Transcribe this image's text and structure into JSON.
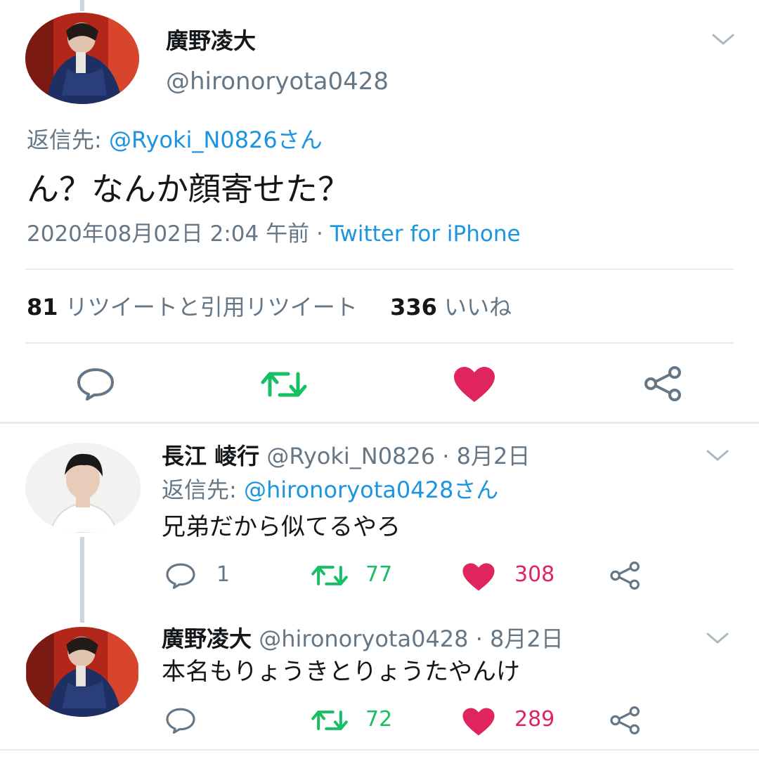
{
  "colors": {
    "link": "#1b95e0",
    "muted": "#657786",
    "retweet_green": "#17bf63",
    "like_red": "#e0245e",
    "divider": "#e6ecf0"
  },
  "main_tweet": {
    "display_name": "廣野凌大",
    "handle": "@hironoryota0428",
    "reply_prefix": "返信先:",
    "reply_to": "@Ryoki_N0826さん",
    "text": "ん？なんか顔寄せた？",
    "timestamp": "2020年08月02日 2:04 午前",
    "separator": "·",
    "source": "Twitter for iPhone",
    "retweet_count": "81",
    "retweet_label": "リツイートと引用リツイート",
    "like_count": "336",
    "like_label": "いいね",
    "icons": [
      "reply-icon",
      "retweet-icon",
      "heart-icon",
      "share-icon",
      "chevron-down-icon"
    ]
  },
  "replies": [
    {
      "display_name": "長江 崚行",
      "handle": "@Ryoki_N0826",
      "date": "· 8月2日",
      "reply_prefix": "返信先:",
      "reply_to": "@hironoryota0428さん",
      "text": "兄弟だから似てるやろ",
      "reply_count": "1",
      "retweet_count": "77",
      "like_count": "308"
    },
    {
      "display_name": "廣野凌大",
      "handle": "@hironoryota0428",
      "date": "· 8月2日",
      "text": "本名もりょうきとりょうたやんけ",
      "reply_count": "",
      "retweet_count": "72",
      "like_count": "289"
    }
  ]
}
